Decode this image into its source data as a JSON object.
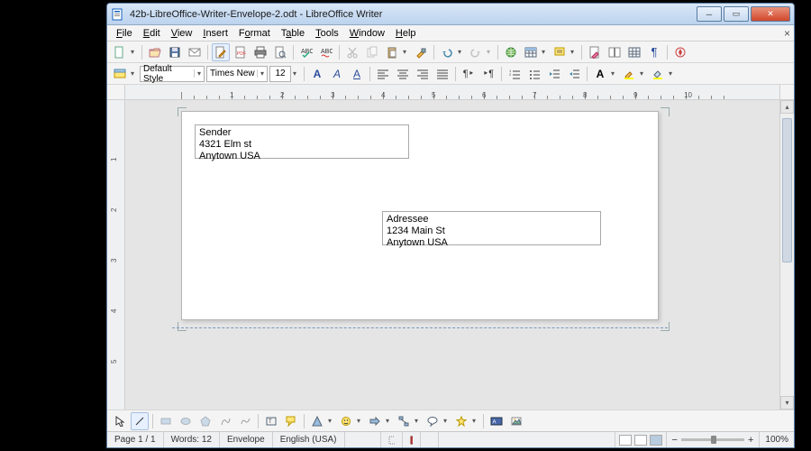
{
  "window": {
    "title": "42b-LibreOffice-Writer-Envelope-2.odt - LibreOffice Writer"
  },
  "menu": {
    "file": "File",
    "edit": "Edit",
    "view": "View",
    "insert": "Insert",
    "format": "Format",
    "table": "Table",
    "tools": "Tools",
    "window": "Window",
    "help": "Help"
  },
  "format_bar": {
    "style": "Default Style",
    "font": "Times New Roman",
    "size": "12"
  },
  "envelope": {
    "sender": {
      "l1": "Sender",
      "l2": "4321 Elm st",
      "l3": "Anytown USA"
    },
    "addressee": {
      "l1": "Adressee",
      "l2": "1234 Main St",
      "l3": "Anytown USA"
    }
  },
  "status": {
    "page": "Page 1 / 1",
    "words": "Words: 12",
    "style": "Envelope",
    "lang": "English (USA)",
    "zoom": "100%"
  }
}
